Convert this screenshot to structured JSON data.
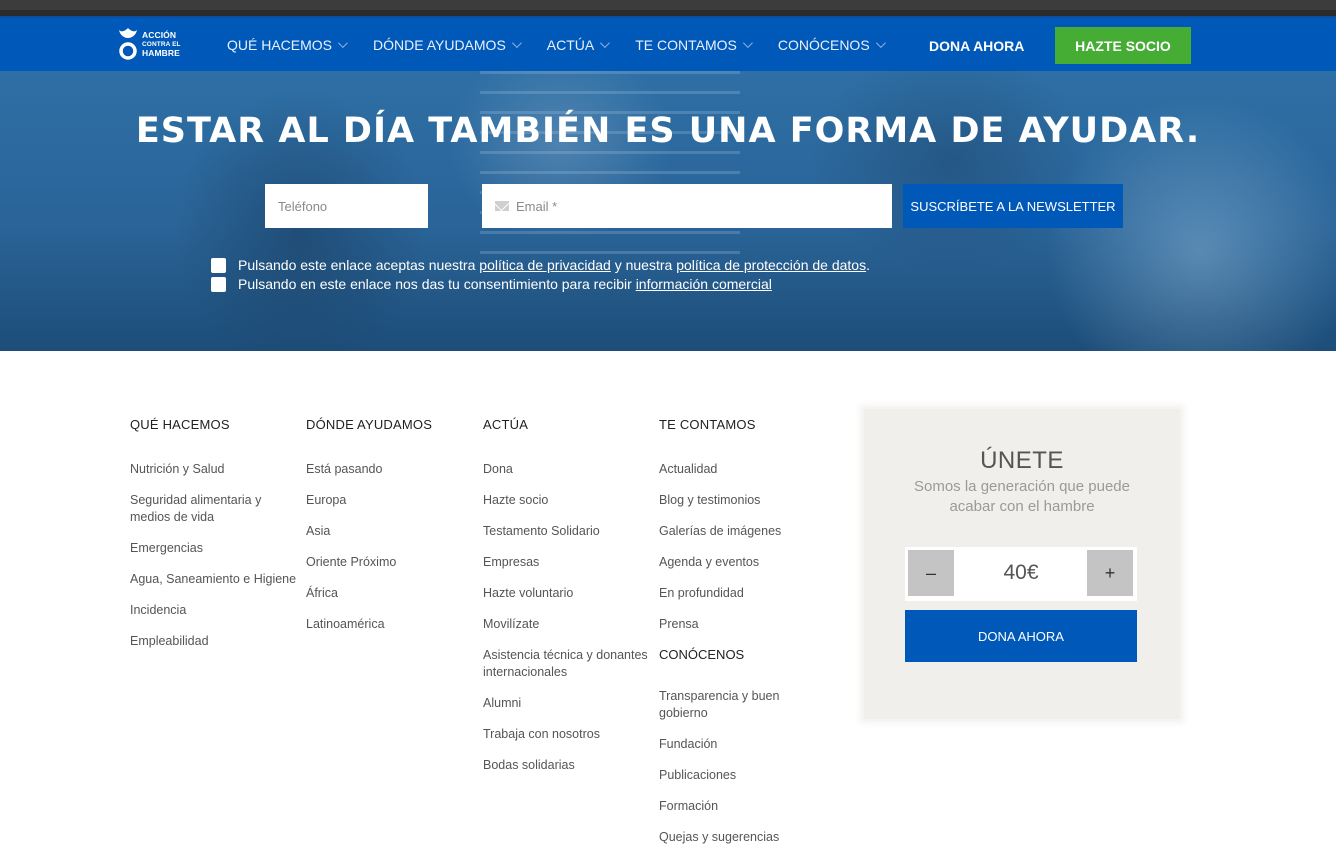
{
  "header": {
    "logo_lines": [
      "ACCIÓN",
      "CONTRA EL",
      "HAMBRE"
    ],
    "menu": [
      {
        "label": "QUÉ HACEMOS"
      },
      {
        "label": "DÓNDE AYUDAMOS"
      },
      {
        "label": "ACTÚA"
      },
      {
        "label": "TE CONTAMOS"
      },
      {
        "label": "CONÓCENOS"
      }
    ],
    "dona_label": "DONA AHORA",
    "hazte_label": "HAZTE SOCIO"
  },
  "hero": {
    "title": "ESTAR AL DÍA TAMBIÉN ES UNA FORMA DE AYUDAR.",
    "phone_placeholder": "Teléfono",
    "email_placeholder": "Email *",
    "subscribe_label": "SUSCRÍBETE A LA NEWSLETTER",
    "consent1": {
      "prefix": "Pulsando este enlace aceptas nuestra ",
      "link1": "política de privacidad",
      "mid": " y nuestra ",
      "link2": "política de protección de datos",
      "suffix": "."
    },
    "consent2": {
      "prefix": "Pulsando en este enlace nos das tu consentimiento para recibir ",
      "link": "información comercial"
    }
  },
  "footer": {
    "que_hacemos": {
      "title": "QUÉ HACEMOS",
      "items": [
        "Nutrición y Salud",
        "Seguridad alimentaria y medios de vida",
        "Emergencias",
        "Agua, Saneamiento e Higiene",
        "Incidencia",
        "Empleabilidad"
      ]
    },
    "donde_ayudamos": {
      "title": "DÓNDE AYUDAMOS",
      "items": [
        "Está pasando",
        "Europa",
        "Asia",
        "Oriente Próximo",
        "África",
        "Latinoamérica"
      ]
    },
    "actua": {
      "title": "ACTÚA",
      "items": [
        "Dona",
        "Hazte socio",
        "Testamento Solidario",
        "Empresas",
        "Hazte voluntario",
        "Movilízate",
        "Asistencia técnica y donantes internacionales",
        "Alumni",
        "Trabaja con nosotros",
        "Bodas solidarias"
      ]
    },
    "te_contamos": {
      "title": "TE CONTAMOS",
      "items": [
        "Actualidad",
        "Blog y testimonios",
        "Galerías de imágenes",
        "Agenda y eventos",
        "En profundidad",
        "Prensa"
      ]
    },
    "conocenos": {
      "title": "CONÓCENOS",
      "items": [
        "Transparencia y buen gobierno",
        "Fundación",
        "Publicaciones",
        "Formación",
        "Quejas y sugerencias"
      ]
    }
  },
  "join": {
    "title": "ÚNETE",
    "subtitle": "Somos la generación que puede acabar con el hambre",
    "minus": "–",
    "plus": "+",
    "amount": "40€",
    "button": "DONA AHORA"
  },
  "colors": {
    "brand_blue": "#0059b8",
    "green": "#45ac34",
    "hero_overlay": "#2e6fa5"
  },
  "icons": [
    "logo-icon",
    "chevron-down-icon",
    "mail-icon",
    "checkbox"
  ]
}
